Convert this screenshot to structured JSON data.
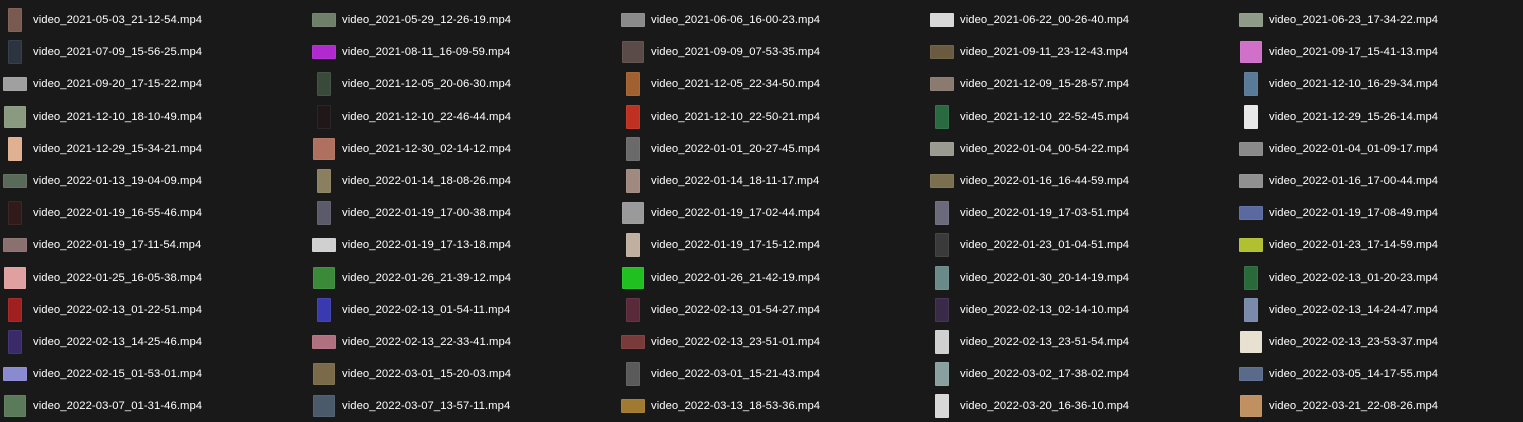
{
  "files": [
    {
      "name": "video_2021-05-03_21-12-54.mp4",
      "thumb_shape": "portrait",
      "thumb_color": "#7a5a50"
    },
    {
      "name": "video_2021-05-29_12-26-19.mp4",
      "thumb_shape": "landscape",
      "thumb_color": "#6f7f6a"
    },
    {
      "name": "video_2021-06-06_16-00-23.mp4",
      "thumb_shape": "landscape",
      "thumb_color": "#8a8a8a"
    },
    {
      "name": "video_2021-06-22_00-26-40.mp4",
      "thumb_shape": "landscape",
      "thumb_color": "#d8d8d8"
    },
    {
      "name": "video_2021-06-23_17-34-22.mp4",
      "thumb_shape": "landscape",
      "thumb_color": "#8f9a88"
    },
    {
      "name": "video_2021-07-09_15-56-25.mp4",
      "thumb_shape": "portrait",
      "thumb_color": "#2c3440"
    },
    {
      "name": "video_2021-08-11_16-09-59.mp4",
      "thumb_shape": "landscape",
      "thumb_color": "#b02ad0"
    },
    {
      "name": "video_2021-09-09_07-53-35.mp4",
      "thumb_shape": "square",
      "thumb_color": "#5a4a48"
    },
    {
      "name": "video_2021-09-11_23-12-43.mp4",
      "thumb_shape": "landscape",
      "thumb_color": "#6a5a40"
    },
    {
      "name": "video_2021-09-17_15-41-13.mp4",
      "thumb_shape": "square",
      "thumb_color": "#d070c8"
    },
    {
      "name": "video_2021-09-20_17-15-22.mp4",
      "thumb_shape": "landscape",
      "thumb_color": "#a0a0a0"
    },
    {
      "name": "video_2021-12-05_20-06-30.mp4",
      "thumb_shape": "portrait",
      "thumb_color": "#3a4a3a"
    },
    {
      "name": "video_2021-12-05_22-34-50.mp4",
      "thumb_shape": "portrait",
      "thumb_color": "#a06030"
    },
    {
      "name": "video_2021-12-09_15-28-57.mp4",
      "thumb_shape": "landscape",
      "thumb_color": "#8a7a70"
    },
    {
      "name": "video_2021-12-10_16-29-34.mp4",
      "thumb_shape": "portrait",
      "thumb_color": "#5a7a9a"
    },
    {
      "name": "video_2021-12-10_18-10-49.mp4",
      "thumb_shape": "square",
      "thumb_color": "#8a9a80"
    },
    {
      "name": "video_2021-12-10_22-46-44.mp4",
      "thumb_shape": "portrait",
      "thumb_color": "#201818"
    },
    {
      "name": "video_2021-12-10_22-50-21.mp4",
      "thumb_shape": "portrait",
      "thumb_color": "#c03020"
    },
    {
      "name": "video_2021-12-10_22-52-45.mp4",
      "thumb_shape": "portrait",
      "thumb_color": "#2a6a40"
    },
    {
      "name": "video_2021-12-29_15-26-14.mp4",
      "thumb_shape": "portrait",
      "thumb_color": "#e8e8e8"
    },
    {
      "name": "video_2021-12-29_15-34-21.mp4",
      "thumb_shape": "portrait",
      "thumb_color": "#e0b090"
    },
    {
      "name": "video_2021-12-30_02-14-12.mp4",
      "thumb_shape": "square",
      "thumb_color": "#b07060"
    },
    {
      "name": "video_2022-01-01_20-27-45.mp4",
      "thumb_shape": "portrait",
      "thumb_color": "#6a6a6a"
    },
    {
      "name": "video_2022-01-04_00-54-22.mp4",
      "thumb_shape": "landscape",
      "thumb_color": "#9a9a90"
    },
    {
      "name": "video_2022-01-04_01-09-17.mp4",
      "thumb_shape": "landscape",
      "thumb_color": "#8a8a8a"
    },
    {
      "name": "video_2022-01-13_19-04-09.mp4",
      "thumb_shape": "landscape",
      "thumb_color": "#5a6a5a"
    },
    {
      "name": "video_2022-01-14_18-08-26.mp4",
      "thumb_shape": "portrait",
      "thumb_color": "#8a8060"
    },
    {
      "name": "video_2022-01-14_18-11-17.mp4",
      "thumb_shape": "portrait",
      "thumb_color": "#a08a80"
    },
    {
      "name": "video_2022-01-16_16-44-59.mp4",
      "thumb_shape": "landscape",
      "thumb_color": "#7a7050"
    },
    {
      "name": "video_2022-01-16_17-00-44.mp4",
      "thumb_shape": "landscape",
      "thumb_color": "#909090"
    },
    {
      "name": "video_2022-01-19_16-55-46.mp4",
      "thumb_shape": "portrait",
      "thumb_color": "#301a1a"
    },
    {
      "name": "video_2022-01-19_17-00-38.mp4",
      "thumb_shape": "portrait",
      "thumb_color": "#5a5a6a"
    },
    {
      "name": "video_2022-01-19_17-02-44.mp4",
      "thumb_shape": "square",
      "thumb_color": "#9a9a9a"
    },
    {
      "name": "video_2022-01-19_17-03-51.mp4",
      "thumb_shape": "portrait",
      "thumb_color": "#6a6a7a"
    },
    {
      "name": "video_2022-01-19_17-08-49.mp4",
      "thumb_shape": "landscape",
      "thumb_color": "#5a6aa0"
    },
    {
      "name": "video_2022-01-19_17-11-54.mp4",
      "thumb_shape": "landscape",
      "thumb_color": "#8a7070"
    },
    {
      "name": "video_2022-01-19_17-13-18.mp4",
      "thumb_shape": "landscape",
      "thumb_color": "#d0d0d0"
    },
    {
      "name": "video_2022-01-19_17-15-12.mp4",
      "thumb_shape": "portrait",
      "thumb_color": "#c0b0a0"
    },
    {
      "name": "video_2022-01-23_01-04-51.mp4",
      "thumb_shape": "portrait",
      "thumb_color": "#3a3a3a"
    },
    {
      "name": "video_2022-01-23_17-14-59.mp4",
      "thumb_shape": "landscape",
      "thumb_color": "#b0c030"
    },
    {
      "name": "video_2022-01-25_16-05-38.mp4",
      "thumb_shape": "square",
      "thumb_color": "#e0a0a0"
    },
    {
      "name": "video_2022-01-26_21-39-12.mp4",
      "thumb_shape": "square",
      "thumb_color": "#3a8a3a"
    },
    {
      "name": "video_2022-01-26_21-42-19.mp4",
      "thumb_shape": "square",
      "thumb_color": "#20c020"
    },
    {
      "name": "video_2022-01-30_20-14-19.mp4",
      "thumb_shape": "portrait",
      "thumb_color": "#6a8a8a"
    },
    {
      "name": "video_2022-02-13_01-20-23.mp4",
      "thumb_shape": "portrait",
      "thumb_color": "#2a6a3a"
    },
    {
      "name": "video_2022-02-13_01-22-51.mp4",
      "thumb_shape": "portrait",
      "thumb_color": "#a02020"
    },
    {
      "name": "video_2022-02-13_01-54-11.mp4",
      "thumb_shape": "portrait",
      "thumb_color": "#3a3ab0"
    },
    {
      "name": "video_2022-02-13_01-54-27.mp4",
      "thumb_shape": "portrait",
      "thumb_color": "#5a2a3a"
    },
    {
      "name": "video_2022-02-13_02-14-10.mp4",
      "thumb_shape": "portrait",
      "thumb_color": "#3a2a4a"
    },
    {
      "name": "video_2022-02-13_14-24-47.mp4",
      "thumb_shape": "portrait",
      "thumb_color": "#7a8aaa"
    },
    {
      "name": "video_2022-02-13_14-25-46.mp4",
      "thumb_shape": "portrait",
      "thumb_color": "#3a2a6a"
    },
    {
      "name": "video_2022-02-13_22-33-41.mp4",
      "thumb_shape": "landscape",
      "thumb_color": "#b07080"
    },
    {
      "name": "video_2022-02-13_23-51-01.mp4",
      "thumb_shape": "landscape",
      "thumb_color": "#7a3a3a"
    },
    {
      "name": "video_2022-02-13_23-51-54.mp4",
      "thumb_shape": "portrait",
      "thumb_color": "#d0d0d0"
    },
    {
      "name": "video_2022-02-13_23-53-37.mp4",
      "thumb_shape": "square",
      "thumb_color": "#e8e0d0"
    },
    {
      "name": "video_2022-02-15_01-53-01.mp4",
      "thumb_shape": "landscape",
      "thumb_color": "#8a8ad0"
    },
    {
      "name": "video_2022-03-01_15-20-03.mp4",
      "thumb_shape": "square",
      "thumb_color": "#7a6a4a"
    },
    {
      "name": "video_2022-03-01_15-21-43.mp4",
      "thumb_shape": "portrait",
      "thumb_color": "#5a5a5a"
    },
    {
      "name": "video_2022-03-02_17-38-02.mp4",
      "thumb_shape": "portrait",
      "thumb_color": "#8aa0a0"
    },
    {
      "name": "video_2022-03-05_14-17-55.mp4",
      "thumb_shape": "landscape",
      "thumb_color": "#5a6a8a"
    },
    {
      "name": "video_2022-03-07_01-31-46.mp4",
      "thumb_shape": "square",
      "thumb_color": "#5a7a5a"
    },
    {
      "name": "video_2022-03-07_13-57-11.mp4",
      "thumb_shape": "square",
      "thumb_color": "#4a5a6a"
    },
    {
      "name": "video_2022-03-13_18-53-36.mp4",
      "thumb_shape": "landscape",
      "thumb_color": "#a07a30"
    },
    {
      "name": "video_2022-03-20_16-36-10.mp4",
      "thumb_shape": "portrait",
      "thumb_color": "#d8d8d8"
    },
    {
      "name": "video_2022-03-21_22-08-26.mp4",
      "thumb_shape": "square",
      "thumb_color": "#c09060"
    }
  ]
}
